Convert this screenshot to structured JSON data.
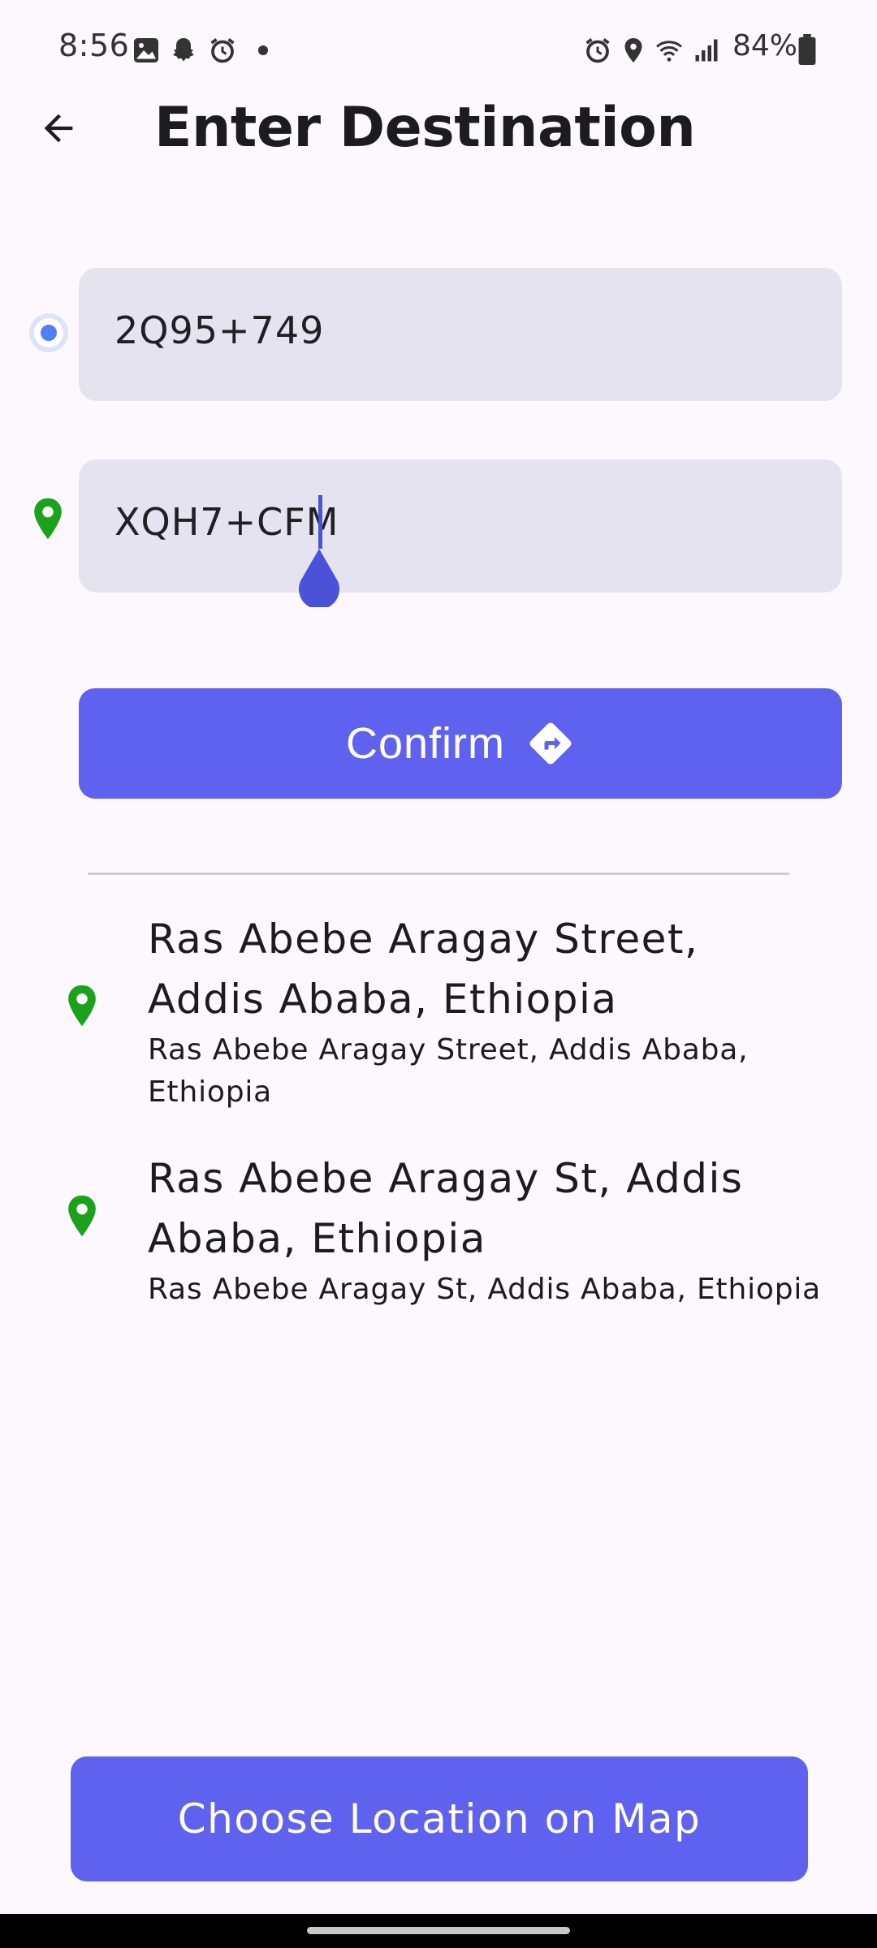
{
  "status_bar": {
    "time": "8:56",
    "battery": "84%",
    "icons_left": [
      "image-icon",
      "snapchat-icon",
      "alarm-icon",
      "dot-icon"
    ],
    "icons_right": [
      "alarm-icon",
      "location-icon",
      "wifi-icon",
      "signal-icon",
      "battery-icon"
    ]
  },
  "header": {
    "title": "Enter Destination",
    "back_icon": "arrow-back-icon"
  },
  "origin_field": {
    "value": "2Q95+749"
  },
  "destination_field": {
    "value": "XQH7+CFM"
  },
  "confirm_button": {
    "label": "Confirm",
    "icon": "directions-icon"
  },
  "suggestions": [
    {
      "title": "Ras Abebe Aragay Street, Addis Ababa, Ethiopia",
      "subtitle": "Ras Abebe Aragay Street, Addis Ababa, Ethiopia"
    },
    {
      "title": "Ras Abebe Aragay St, Addis Ababa, Ethiopia",
      "subtitle": "Ras Abebe Aragay St, Addis Ababa, Ethiopia"
    }
  ],
  "map_button": {
    "label": "Choose Location on Map"
  },
  "colors": {
    "accent": "#5f62ee",
    "field_bg": "#e5e3ef",
    "pin_green": "#1aa31a",
    "background": "#fdf8fd"
  }
}
